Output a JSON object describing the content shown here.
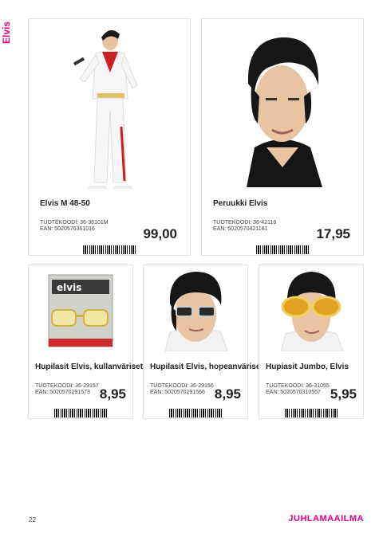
{
  "section_tab": "Elvis",
  "page_number": "22",
  "brand": "JUHLAMAAILMA",
  "products": [
    {
      "name": "Elvis M 48-50",
      "code_label": "TUOTEKOODI: 36-36101M",
      "ean_label": "EAN:  5020570361016",
      "price": "99,00",
      "image": "elvis-jumpsuit-costume"
    },
    {
      "name": "Peruukki Elvis",
      "code_label": "TUOTEKOODI: 36-42116",
      "ean_label": "EAN:  5020570421161",
      "price": "17,95",
      "image": "elvis-wig"
    },
    {
      "name": "Hupilasit Elvis, kullanväriset",
      "code_label": "TUOTEKOODI: 36-29157",
      "ean_label": "EAN:  5020570291573",
      "price": "8,95",
      "image": "gold-glasses-package"
    },
    {
      "name": "Hupilasit Elvis, hopeanväriset",
      "code_label": "TUOTEKOODI: 36-29156",
      "ean_label": "EAN:  5020570291566",
      "price": "8,95",
      "image": "silver-glasses-model"
    },
    {
      "name": "Hupiasit Jumbo, Elvis",
      "code_label": "TUOTEKOODI: 36-31055",
      "ean_label": "EAN:  5020570310557",
      "price": "5,95",
      "image": "jumbo-glasses-model"
    }
  ],
  "colors": {
    "accent": "#e6007e",
    "text": "#222222",
    "border": "#e1e1e1"
  }
}
